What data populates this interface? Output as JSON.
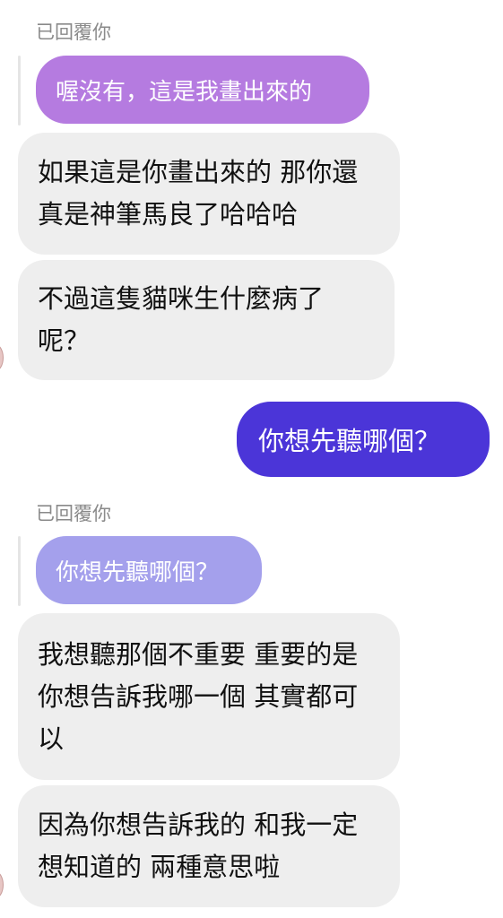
{
  "thread": {
    "reply_label_1": "已回覆你",
    "quoted_1": "喔沒有，這是我畫出來的",
    "msg_1": "如果這是你畫出來的 那你還真是神筆馬良了哈哈哈",
    "msg_2": "不過這隻貓咪生什麼病了呢？",
    "sent_1": "你想先聽哪個？",
    "reply_label_2": "已回覆你",
    "quoted_2": "你想先聽哪個？",
    "msg_3": "我想聽那個不重要 重要的是你想告訴我哪一個 其實都可以",
    "msg_4": "因為你想告訴我的 和我一定想知道的 兩種意思啦"
  },
  "colors": {
    "quoted_1_bg": "#b57be0",
    "quoted_2_bg": "#a4a0ec",
    "received_bg": "#eeeeee",
    "sent_bg": "#4b35d8"
  }
}
